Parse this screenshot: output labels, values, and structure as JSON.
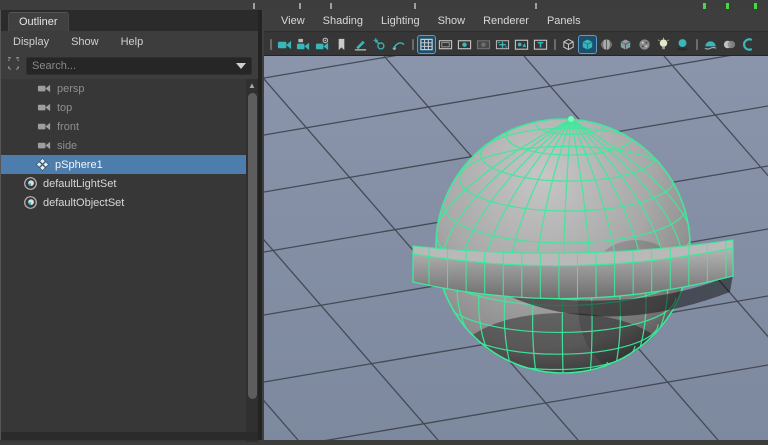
{
  "colors": {
    "selection_blue": "#4c7dad",
    "wireframe_green": "#3fe89c",
    "pole_highlight_green": "#74ffb8",
    "icon_teal": "#38b6b9",
    "icon_gray": "#c4c4c4",
    "viewport_top": "#8a94ab",
    "viewport_bottom": "#7d899e",
    "grid_line": "#3a3f48",
    "shelf_tick_gray": "#9aa0a6",
    "shelf_tick_green": "#46d945"
  },
  "outliner": {
    "tab_label": "Outliner",
    "menus": [
      {
        "label": "Display"
      },
      {
        "label": "Show"
      },
      {
        "label": "Help"
      }
    ],
    "search_placeholder": "Search...",
    "items": [
      {
        "label": "persp",
        "icon": "camera-icon",
        "muted": true,
        "selected": false
      },
      {
        "label": "top",
        "icon": "camera-icon",
        "muted": true,
        "selected": false
      },
      {
        "label": "front",
        "icon": "camera-icon",
        "muted": true,
        "selected": false
      },
      {
        "label": "side",
        "icon": "camera-icon",
        "muted": true,
        "selected": false
      },
      {
        "label": "pSphere1",
        "icon": "poly-mesh-icon",
        "muted": false,
        "selected": true
      },
      {
        "label": "defaultLightSet",
        "icon": "set-icon",
        "muted": false,
        "selected": false
      },
      {
        "label": "defaultObjectSet",
        "icon": "set-icon",
        "muted": false,
        "selected": false
      }
    ]
  },
  "viewport": {
    "menus": [
      {
        "label": "View"
      },
      {
        "label": "Shading"
      },
      {
        "label": "Lighting"
      },
      {
        "label": "Show"
      },
      {
        "label": "Renderer"
      },
      {
        "label": "Panels"
      }
    ],
    "toolbar": [
      {
        "name": "grip",
        "tint": "gray",
        "active": false
      },
      {
        "name": "select-camera",
        "tint": "teal",
        "active": false
      },
      {
        "name": "lock-camera",
        "tint": "teal",
        "active": false
      },
      {
        "name": "camera-attributes",
        "tint": "teal",
        "active": false
      },
      {
        "name": "bookmark",
        "tint": "gray",
        "active": false
      },
      {
        "name": "grease-pencil",
        "tint": "teal",
        "active": false
      },
      {
        "name": "pan-zoom",
        "tint": "teal",
        "active": false
      },
      {
        "name": "pen-curve",
        "tint": "teal",
        "active": false
      },
      {
        "name": "grip",
        "tint": "gray",
        "active": false
      },
      {
        "name": "grid",
        "tint": "gray",
        "active": true
      },
      {
        "name": "film-gate",
        "tint": "gray",
        "active": false
      },
      {
        "name": "resolution-gate",
        "tint": "teal",
        "active": false
      },
      {
        "name": "gate-mask",
        "tint": "gray",
        "active": false
      },
      {
        "name": "field-chart",
        "tint": "teal",
        "active": false
      },
      {
        "name": "safe-action",
        "tint": "teal",
        "active": false
      },
      {
        "name": "safe-title",
        "tint": "teal",
        "active": false
      },
      {
        "name": "grip",
        "tint": "gray",
        "active": false
      },
      {
        "name": "wireframe-cube",
        "tint": "gray",
        "active": false
      },
      {
        "name": "shaded-cube",
        "tint": "teal",
        "active": true
      },
      {
        "name": "wireframe-on-shaded",
        "tint": "gray",
        "active": false
      },
      {
        "name": "textured-cube",
        "tint": "teal",
        "active": false
      },
      {
        "name": "checker-sphere",
        "tint": "gray",
        "active": false
      },
      {
        "name": "light-bulb",
        "tint": "gray",
        "active": false
      },
      {
        "name": "shadow-sphere",
        "tint": "teal",
        "active": false
      },
      {
        "name": "grip",
        "tint": "gray",
        "active": false
      },
      {
        "name": "occlusion-dome",
        "tint": "teal",
        "active": false
      },
      {
        "name": "motion-blur",
        "tint": "gray",
        "active": false
      },
      {
        "name": "anti-alias",
        "tint": "teal",
        "active": false
      }
    ]
  }
}
